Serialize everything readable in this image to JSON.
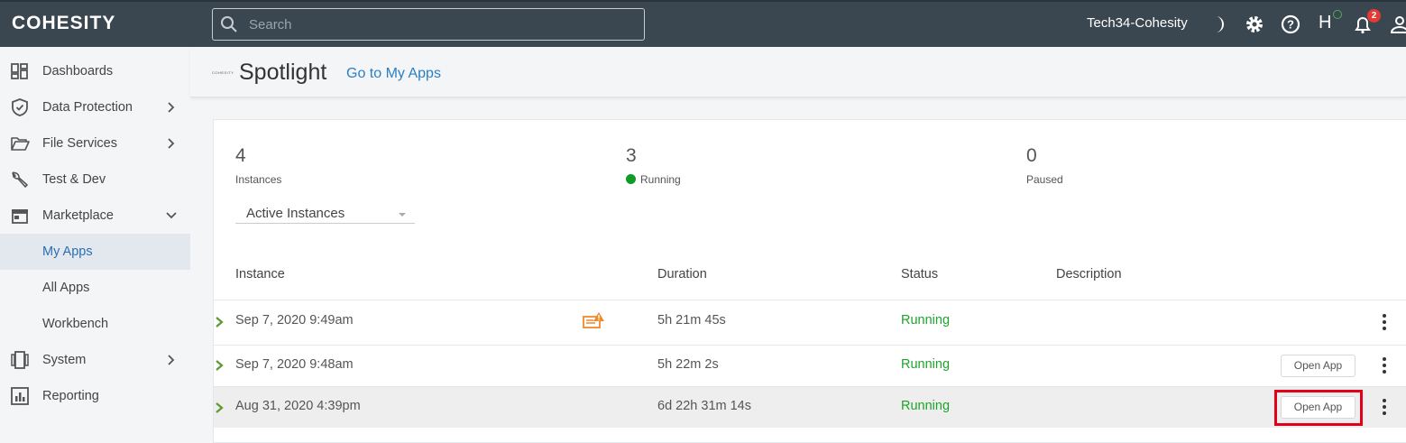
{
  "topbar": {
    "logo": "COHESITY",
    "search_placeholder": "Search",
    "cluster_name": "Tech34-Cohesity",
    "user_initial": "H",
    "notification_count": "2",
    "icons": [
      "search-icon",
      "moon-icon",
      "gear-icon",
      "help-icon",
      "bell-icon",
      "user-icon"
    ]
  },
  "sidebar": {
    "items": [
      {
        "label": "Dashboards",
        "icon": "dashboard-icon"
      },
      {
        "label": "Data Protection",
        "icon": "shield-icon"
      },
      {
        "label": "File Services",
        "icon": "folder-icon"
      },
      {
        "label": "Test & Dev",
        "icon": "wrench-icon"
      },
      {
        "label": "Marketplace",
        "icon": "store-icon"
      },
      {
        "label": "My Apps"
      },
      {
        "label": "All Apps"
      },
      {
        "label": "Workbench"
      },
      {
        "label": "System",
        "icon": "system-icon"
      },
      {
        "label": "Reporting",
        "icon": "reporting-icon"
      }
    ]
  },
  "header": {
    "mini_logo": "COHESITY",
    "title": "Spotlight",
    "link": "Go to My Apps"
  },
  "stats": [
    {
      "value": "4",
      "label": "Instances"
    },
    {
      "value": "3",
      "label": "Running"
    },
    {
      "value": "0",
      "label": "Paused"
    }
  ],
  "filter": {
    "selected": "Active Instances"
  },
  "table": {
    "columns": [
      "Instance",
      "Duration",
      "Status",
      "Description"
    ],
    "rows": [
      {
        "instance": "Sep 7, 2020 9:49am",
        "duration": "5h 21m 45s",
        "status": "Running",
        "description": "",
        "has_warning": true,
        "button": ""
      },
      {
        "instance": "Sep 7, 2020 9:48am",
        "duration": "5h 22m 2s",
        "status": "Running",
        "description": "",
        "has_warning": false,
        "button": "Open App"
      },
      {
        "instance": "Aug 31, 2020 4:39pm",
        "duration": "6d 22h 31m 14s",
        "status": "Running",
        "description": "",
        "has_warning": false,
        "button": "Open App"
      }
    ]
  },
  "colors": {
    "topbar": "#3b4750",
    "running_green": "#1fa32c",
    "link_blue": "#2a7fc4",
    "highlight_red": "#e3001b",
    "warning_orange": "#f0892c"
  }
}
